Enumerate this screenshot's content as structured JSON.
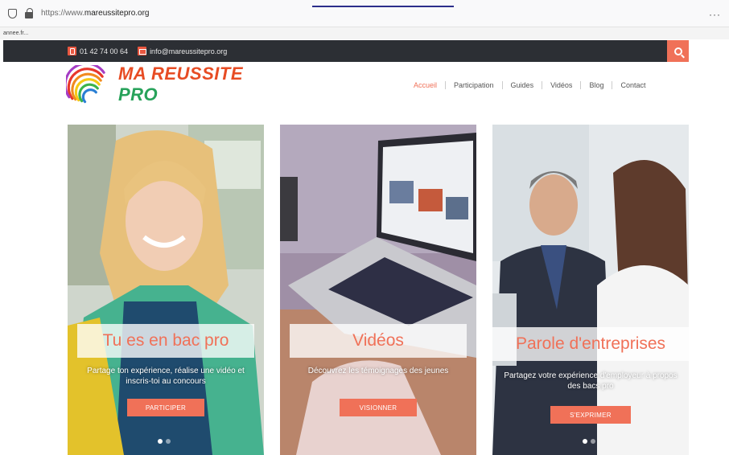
{
  "browser": {
    "url_prefix": "https://www.",
    "url_host": "mareussitepro.org",
    "menu_label": "···",
    "bookmark": "annee.fr..."
  },
  "topbar": {
    "phone": "01 42 74 00 64",
    "email": "info@mareussitepro.org"
  },
  "logo": {
    "part1": "MA ",
    "part2": "REUSSITE ",
    "part3": "PRO"
  },
  "nav": {
    "items": [
      "Accueil",
      "Participation",
      "Guides",
      "Vidéos",
      "Blog",
      "Contact"
    ],
    "active_index": 0
  },
  "cards": [
    {
      "title": "Tu es en bac pro",
      "description": "Partage ton expérience, réalise une vidéo et inscris-toi au concours",
      "button": "PARTICIPER"
    },
    {
      "title": "Vidéos",
      "description": "Découvrez les témoignages des jeunes",
      "button": "VISIONNER"
    },
    {
      "title": "Parole d'entreprises",
      "description": "Partagez votre expérience d'employeur à propos des bacs pro",
      "button": "S'EXPRIMER"
    }
  ],
  "colors": {
    "accent": "#f07158",
    "topbar_bg": "#2c2f34",
    "logo_red": "#e74c24",
    "logo_green": "#27a25a"
  }
}
